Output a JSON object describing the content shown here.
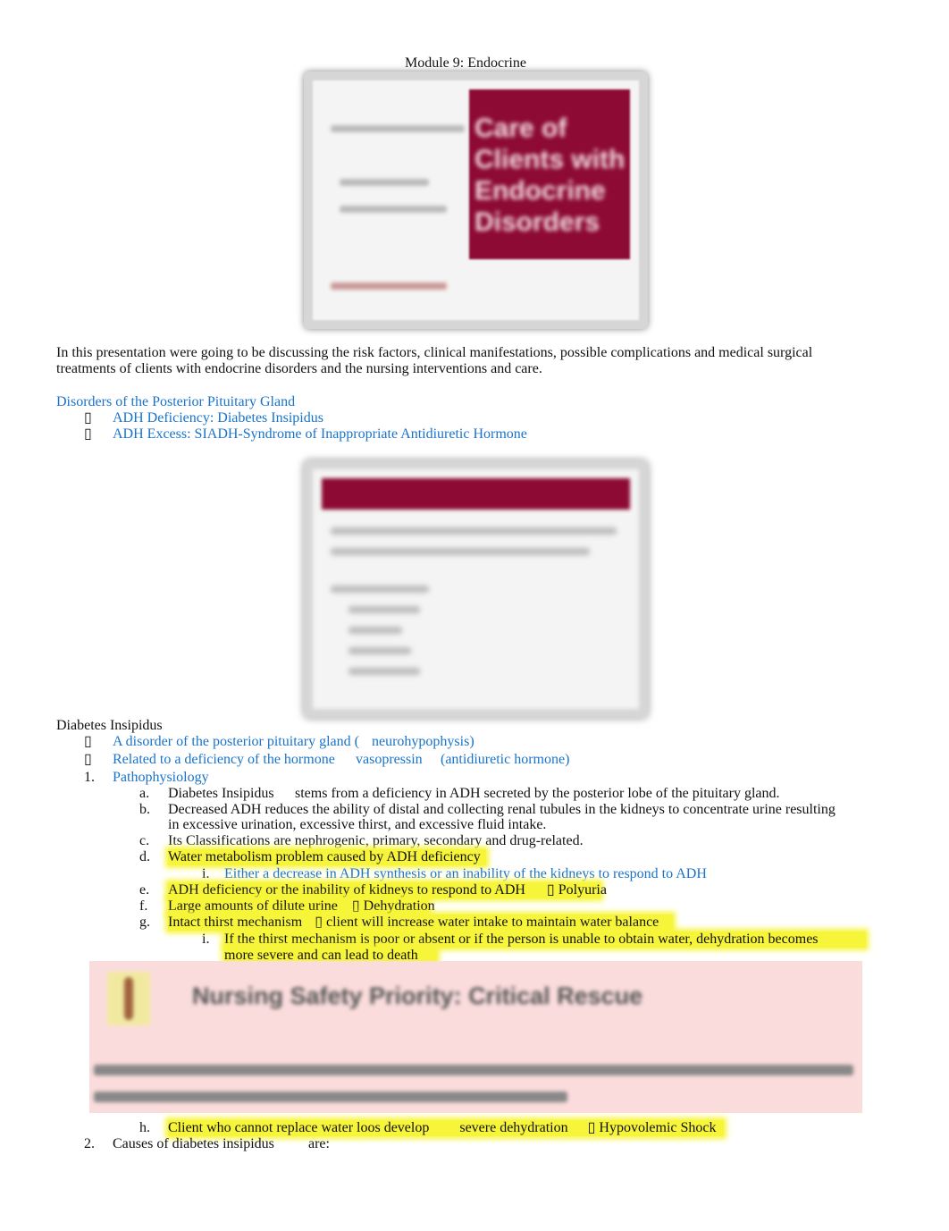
{
  "header": {
    "title": "Module 9: Endocrine"
  },
  "slide1": {
    "title_blurred": "Care of Clients with Endocrine Disorders",
    "accent": "#8c0a33"
  },
  "intro": {
    "line1": "In this presentation were going to be discussing the risk factors, clinical manifestations, possible complications and medical surgical",
    "line2": "treatments of clients with endocrine disorders and the nursing interventions and care."
  },
  "posterior": {
    "heading": "Disorders of the Posterior Pituitary Gland",
    "bullet": "▯",
    "items": [
      "ADH Deficiency: Diabetes Insipidus",
      "ADH Excess: SIADH-Syndrome of Inappropriate Antidiuretic Hormone"
    ]
  },
  "di": {
    "heading": "Diabetes Insipidus",
    "bullet": "▯",
    "b1a": "A disorder of the posterior pituitary gland (",
    "b1b": "neurohypophysis)",
    "b2a": "Related to a deficiency of the hormone",
    "b2b": "vasopressin",
    "b2c": "(antidiuretic hormone)",
    "n1": "1.",
    "patho": "Pathophysiology",
    "a_m": "a.",
    "a1": "Diabetes Insipidus",
    "a2": "stems from a deficiency in ADH secreted by the posterior lobe of the pituitary gland.",
    "b_m": "b.",
    "b1": "Decreased ADH reduces the ability of distal and collecting renal tubules in the kidneys to concentrate urine resulting",
    "b2": "in excessive urination, excessive thirst, and excessive fluid intake.",
    "c_m": "c.",
    "c": "Its Classifications are nephrogenic, primary, secondary and drug-related.",
    "d_m": "d.",
    "d": "Water metabolism problem caused by ADH deficiency",
    "di_m": "i.",
    "di": "Either a decrease in ADH synthesis or an inability of the kidneys to respond to ADH",
    "e_m": "e.",
    "e1": "ADH deficiency or the inability of kidneys to respond to ADH",
    "e2": "▯ Polyuria",
    "f_m": "f.",
    "f1": "Large amounts of dilute urine",
    "f2": "▯ Dehydration",
    "g_m": "g.",
    "g1": "Intact thirst mechanism",
    "g2": "▯ client will increase water intake to maintain water balance",
    "gi_m": "i.",
    "gi1": "If the thirst mechanism is poor or absent or if the person is unable to obtain water, dehydration becomes",
    "gi2": "more severe and can lead to death",
    "h_m": "h.",
    "h1": "Client who cannot replace water loos develop",
    "h2": "severe dehydration",
    "h3": "▯ Hypovolemic Shock",
    "n2": "2.",
    "causes1": "Causes of diabetes insipidus",
    "causes2": "are:"
  },
  "callout": {
    "title_blurred": "Nursing Safety Priority: Critical Rescue",
    "bg": "#fadcdc"
  }
}
